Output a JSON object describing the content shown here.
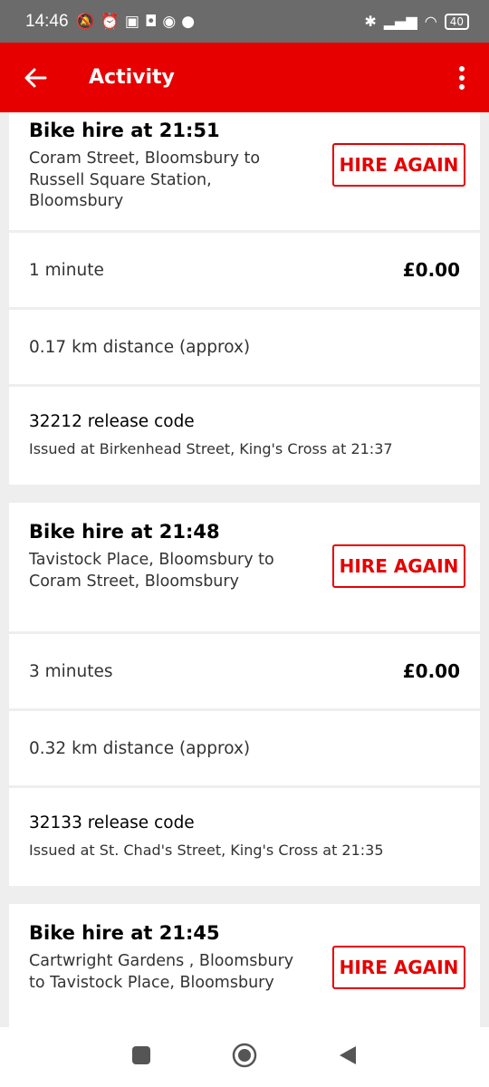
{
  "status_bar": {
    "time": "14:46",
    "left_icons": [
      "mute-icon",
      "alarm-icon",
      "nfc-icon",
      "teams-icon",
      "chrome-icon",
      "reddit-icon"
    ],
    "battery": "40"
  },
  "app_bar": {
    "title": "Activity"
  },
  "hires": [
    {
      "title": "Bike hire at 21:51",
      "route": "Coram Street, Bloomsbury to Russell Square Station, Bloomsbury",
      "button": "HIRE AGAIN",
      "duration": "1 minute",
      "price": "£0.00",
      "distance": "0.17 km distance (approx)",
      "release_code": "32212 release code",
      "issued": "Issued at Birkenhead Street, King's Cross at 21:37"
    },
    {
      "title": "Bike hire at 21:48",
      "route": "Tavistock Place, Bloomsbury to Coram Street, Bloomsbury",
      "button": "HIRE AGAIN",
      "duration": "3 minutes",
      "price": "£0.00",
      "distance": "0.32 km distance (approx)",
      "release_code": "32133 release code",
      "issued": "Issued at St. Chad's Street, King's Cross at 21:35"
    },
    {
      "title": "Bike hire at 21:45",
      "route": "Cartwright Gardens , Bloomsbury to Tavistock Place, Bloomsbury",
      "button": "HIRE AGAIN"
    }
  ],
  "colors": {
    "brand_red": "#e60000",
    "status_bar": "#6b6b6b",
    "background": "#eeeeee"
  }
}
